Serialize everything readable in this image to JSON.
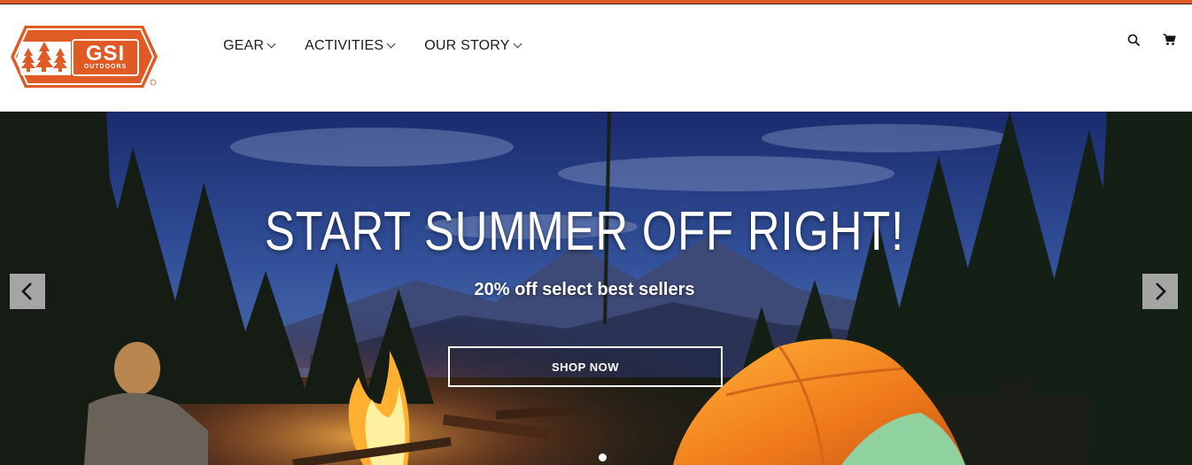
{
  "brand": {
    "logo_line1": "GSI",
    "logo_line2": "OUTDOORS",
    "accent_color": "#e05a25"
  },
  "nav": {
    "items": [
      {
        "label": "GEAR"
      },
      {
        "label": "ACTIVITIES"
      },
      {
        "label": "OUR STORY"
      }
    ]
  },
  "header_icons": [
    "search-icon",
    "cart-icon"
  ],
  "hero": {
    "title": "START SUMMER OFF RIGHT!",
    "subtitle": "20% off select best sellers",
    "cta_label": "SHOP NOW",
    "slide_count": 1
  }
}
